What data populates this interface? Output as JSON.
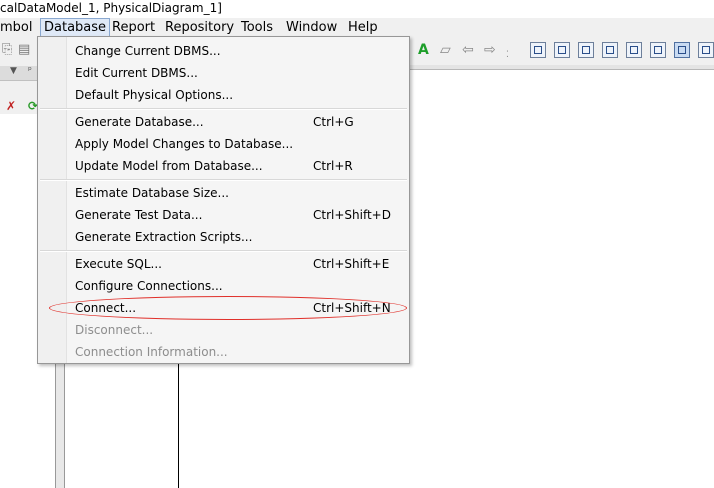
{
  "window": {
    "title_fragment": "calDataModel_1, PhysicalDiagram_1]"
  },
  "menubar": {
    "items": [
      "mbol",
      "Database",
      "Report",
      "Repository",
      "Tools",
      "Window",
      "Help"
    ]
  },
  "database_menu": {
    "groups": [
      [
        {
          "label": "Change Current DBMS...",
          "shortcut": ""
        },
        {
          "label": "Edit Current DBMS...",
          "shortcut": ""
        },
        {
          "label": "Default Physical Options...",
          "shortcut": ""
        }
      ],
      [
        {
          "label": "Generate Database...",
          "shortcut": "Ctrl+G"
        },
        {
          "label": "Apply Model Changes to Database...",
          "shortcut": ""
        },
        {
          "label": "Update Model from Database...",
          "shortcut": "Ctrl+R"
        }
      ],
      [
        {
          "label": "Estimate Database Size...",
          "shortcut": ""
        },
        {
          "label": "Generate Test Data...",
          "shortcut": "Ctrl+Shift+D"
        },
        {
          "label": "Generate Extraction Scripts...",
          "shortcut": ""
        }
      ],
      [
        {
          "label": "Execute SQL...",
          "shortcut": "Ctrl+Shift+E"
        },
        {
          "label": "Configure Connections...",
          "shortcut": ""
        },
        {
          "label": "Connect...",
          "shortcut": "Ctrl+Shift+N"
        },
        {
          "label": "Disconnect...",
          "shortcut": "",
          "disabled": true
        },
        {
          "label": "Connection Information...",
          "shortcut": "",
          "disabled": true
        }
      ]
    ]
  },
  "annotation": {
    "color": "#e0302a"
  },
  "icons": [
    "copy-icon",
    "paste-icon",
    "delete-icon",
    "refresh-icon",
    "text-a-icon",
    "edit-icon",
    "undo-icon",
    "redo-icon",
    "diagram-tool-icon"
  ]
}
